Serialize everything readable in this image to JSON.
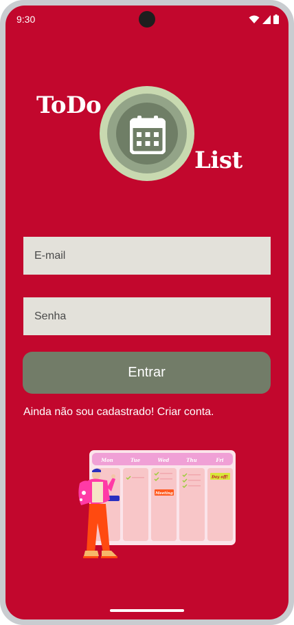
{
  "status_bar": {
    "time": "9:30",
    "icons": [
      "wifi-icon",
      "cell-signal-icon",
      "battery-icon"
    ]
  },
  "logo": {
    "word1": "ToDo",
    "word2": "List",
    "icon": "calendar-icon"
  },
  "form": {
    "email_placeholder": "E-mail",
    "email_value": "",
    "password_placeholder": "Senha",
    "password_value": "",
    "submit_label": "Entrar",
    "register_link": "Ainda não sou cadastrado! Criar conta."
  },
  "illustration": {
    "days": [
      "Mon",
      "Tue",
      "Wed",
      "Thu",
      "Fri"
    ],
    "meeting_tag": "Meeting",
    "dayoff_tag": "Day off!"
  },
  "colors": {
    "background": "#c2072d",
    "input_bg": "#e3e1da",
    "button_bg": "#727c68",
    "logo_ring": "#c8d9b0"
  }
}
